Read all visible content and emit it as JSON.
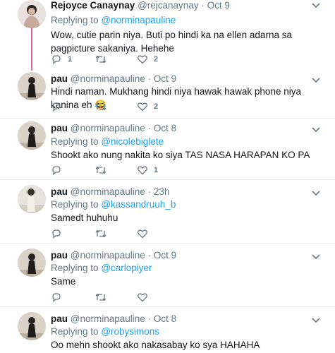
{
  "tweets": [
    {
      "name": "Rejoyce Canaynay",
      "handle": "@rejcanaynay",
      "dot": "·",
      "time": "Oct 9",
      "replying_prefix": "Replying to",
      "replying_to": "@norminapauline",
      "text": "Wow, cutie parin niya. Buti po hindi ka na ellen adarna sa pagpicture sakaniya. Hehehe",
      "replies": "1",
      "retweets": "",
      "likes": "2"
    },
    {
      "name": "pau",
      "handle": "@norminapauline",
      "dot": "·",
      "time": "Oct 9",
      "text": "Hindi naman. Mukhang hindi niya hawak hawak phone niya kanina eh 😂",
      "replies": "",
      "retweets": "",
      "likes": "2"
    },
    {
      "name": "pau",
      "handle": "@norminapauline",
      "dot": "·",
      "time": "Oct 8",
      "replying_prefix": "Replying to",
      "replying_to": "@nicolebiglete",
      "text": "Shookt ako nung nakita ko siya TAS NASA HARAPAN KO PA",
      "replies": "",
      "retweets": "",
      "likes": "1"
    },
    {
      "name": "pau",
      "handle": "@norminapauline",
      "dot": "·",
      "time": "23h",
      "replying_prefix": "Replying to",
      "replying_to": "@kassandruuh_b",
      "text": "Samedt huhuhu",
      "replies": "",
      "retweets": "",
      "likes": ""
    },
    {
      "name": "pau",
      "handle": "@norminapauline",
      "dot": "·",
      "time": "Oct 9",
      "replying_prefix": "Replying to",
      "replying_to": "@carlopiyer",
      "text": "Same",
      "replies": "",
      "retweets": "",
      "likes": ""
    },
    {
      "name": "pau",
      "handle": "@norminapauline",
      "dot": "·",
      "time": "Oct 8",
      "replying_prefix": "Replying to",
      "replying_to": "@robysimons",
      "text": "Oo mehn shookt ako nakasabay ko sya HAHAHA"
    }
  ],
  "icons": {
    "reply": "reply-icon",
    "retweet": "retweet-icon",
    "like": "heart-icon",
    "more": "chevron-down-icon"
  },
  "colors": {
    "link": "#1da1f2",
    "thread_line": "#e06c9f",
    "muted": "#657786"
  }
}
